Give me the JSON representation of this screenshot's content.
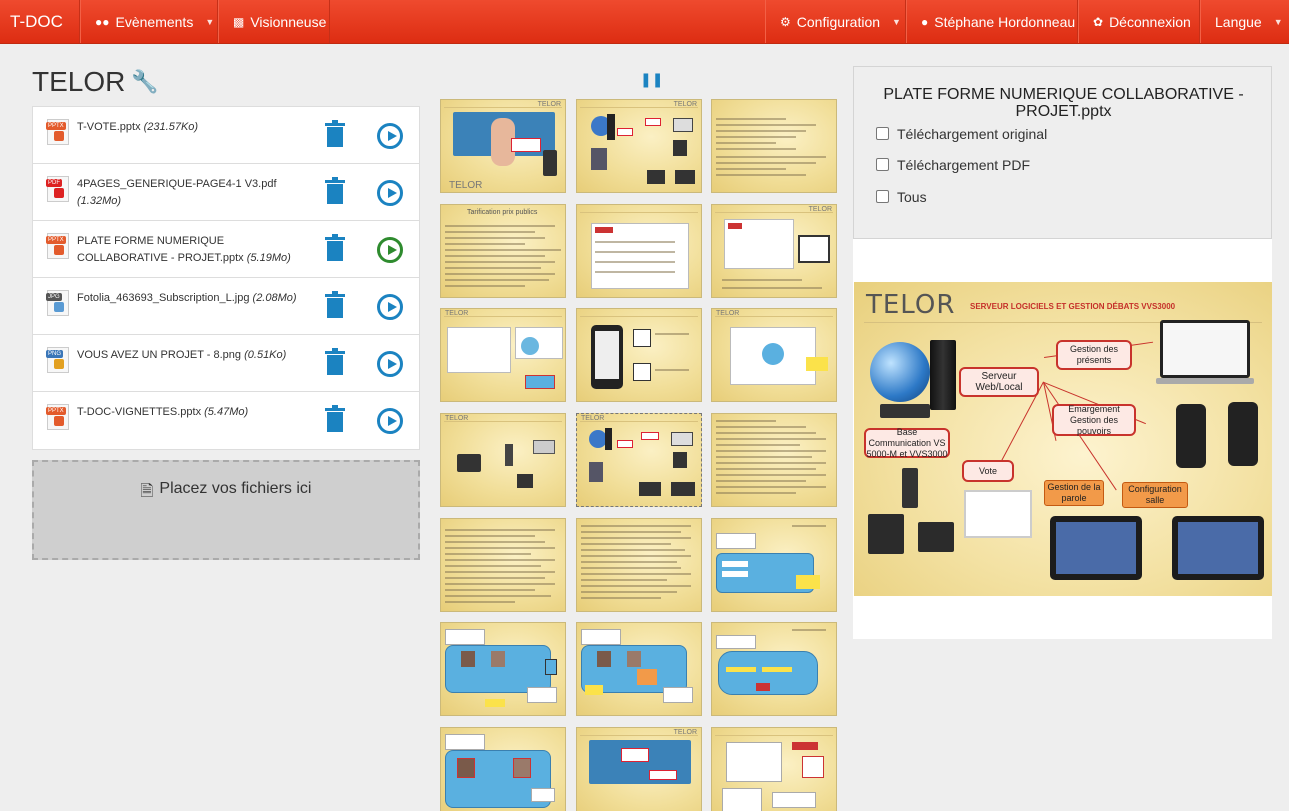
{
  "navbar": {
    "brand": "T-DOC",
    "events": "Evènements",
    "viewer": "Visionneuse",
    "config": "Configuration",
    "user": "Stéphane Hordonneau",
    "logout": "Déconnexion",
    "lang": "Langue"
  },
  "page": {
    "title": "TELOR"
  },
  "files": [
    {
      "type": "PPTX",
      "name": "T-VOTE.pptx",
      "size": "(231.57Ko)"
    },
    {
      "type": "PDF",
      "name": "4PAGES_GENERIQUE-PAGE4-1 V3.pdf",
      "size": "(1.32Mo)"
    },
    {
      "type": "PPTX",
      "name": "PLATE FORME NUMERIQUE COLLABORATIVE - PROJET.pptx",
      "size": "(5.19Mo)"
    },
    {
      "type": "JPG",
      "name": "Fotolia_463693_Subscription_L.jpg",
      "size": "(2.08Mo)"
    },
    {
      "type": "PNG",
      "name": "VOUS AVEZ UN PROJET - 8.png",
      "size": "(0.51Ko)"
    },
    {
      "type": "PPTX",
      "name": "T-DOC-VIGNETTES.pptx",
      "size": "(5.47Mo)"
    }
  ],
  "dropzone": "Placez vos fichiers ici",
  "thumb_titles": {
    "tarif": "Tarification prix publics",
    "telor": "TELOR"
  },
  "download": {
    "title": "PLATE FORME NUMERIQUE COLLABORATIVE - PROJET.pptx",
    "original": "Téléchargement original",
    "pdf": "Téléchargement PDF",
    "all": "Tous"
  },
  "preview": {
    "logo": "TELOR",
    "subtitle": "SERVEUR LOGICIELS ET GESTION DÉBATS VVS3000",
    "serveur": "Serveur Web/Local",
    "presents": "Gestion des présents",
    "emargement": "Emargement Gestion des pouvoirs",
    "base": "Base Communication VS 5000-M et VVS3000",
    "vote": "Vote",
    "parole": "Gestion de la parole",
    "salle": "Configuration salle"
  },
  "colors": {
    "navbar": "#e23a1e",
    "accent": "#1b83c1",
    "active_play": "#2e8b2e",
    "slide_red": "#c8332c",
    "slide_orange": "#f29a49"
  }
}
